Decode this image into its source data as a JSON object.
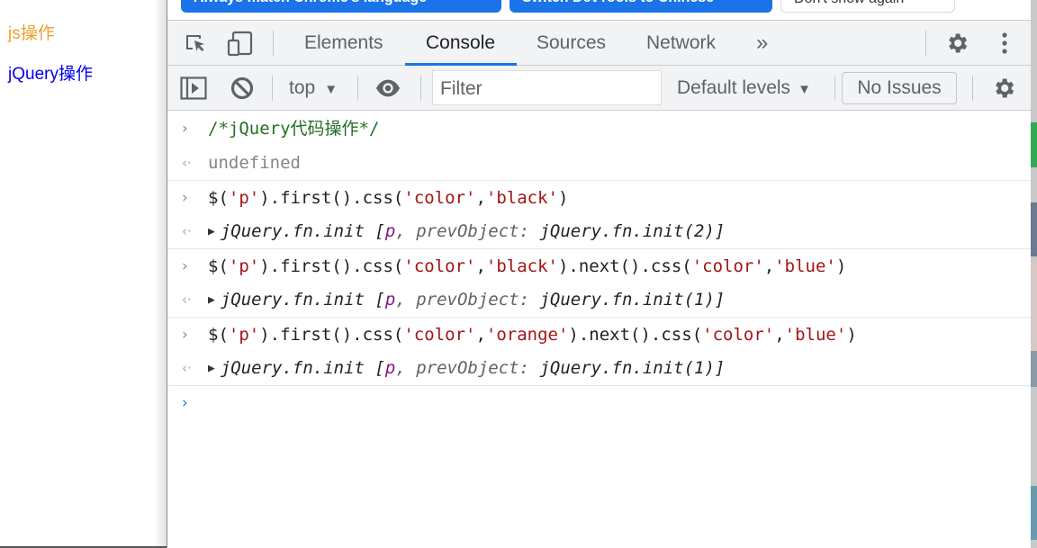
{
  "page": {
    "paragraphs": [
      {
        "text": "js操作",
        "color": "#f0a030"
      },
      {
        "text": "jQuery操作",
        "color": "#0000ee"
      }
    ]
  },
  "infobar": {
    "buttons": [
      "Always match Chrome's language",
      "Switch DevTools to Chinese",
      "Don't show again"
    ]
  },
  "tabbar": {
    "icons": [
      "inspect-element-icon",
      "device-toolbar-icon"
    ],
    "tabs": [
      {
        "label": "Elements",
        "active": false
      },
      {
        "label": "Console",
        "active": true
      },
      {
        "label": "Sources",
        "active": false
      },
      {
        "label": "Network",
        "active": false
      }
    ],
    "more_tabs": "»",
    "accent": "#1a73e8"
  },
  "toolbar": {
    "context": "top",
    "filter_placeholder": "Filter",
    "levels": "Default levels",
    "issues": "No Issues"
  },
  "console": {
    "entries": [
      {
        "input": [
          {
            "t": "cmt",
            "v": "/*jQuery代码操作*/"
          }
        ],
        "output": {
          "type": "undefined",
          "text": "undefined"
        }
      },
      {
        "input": [
          {
            "t": "plain",
            "v": "$("
          },
          {
            "t": "str",
            "v": "'p'"
          },
          {
            "t": "plain",
            "v": ").first().css("
          },
          {
            "t": "str",
            "v": "'color'"
          },
          {
            "t": "plain",
            "v": ","
          },
          {
            "t": "str",
            "v": "'black'"
          },
          {
            "t": "plain",
            "v": ")"
          }
        ],
        "output": {
          "type": "object",
          "head": "jQuery.fn.init [",
          "p": "p",
          "key": ", prevObject:",
          "tail": " jQuery.fn.init(2)]"
        }
      },
      {
        "input": [
          {
            "t": "plain",
            "v": "$("
          },
          {
            "t": "str",
            "v": "'p'"
          },
          {
            "t": "plain",
            "v": ").first().css("
          },
          {
            "t": "str",
            "v": "'color'"
          },
          {
            "t": "plain",
            "v": ","
          },
          {
            "t": "str",
            "v": "'black'"
          },
          {
            "t": "plain",
            "v": ").next().css("
          },
          {
            "t": "str",
            "v": "'color'"
          },
          {
            "t": "plain",
            "v": ","
          },
          {
            "t": "str",
            "v": "'blue'"
          },
          {
            "t": "plain",
            "v": ")"
          }
        ],
        "output": {
          "type": "object",
          "head": "jQuery.fn.init [",
          "p": "p",
          "key": ", prevObject:",
          "tail": " jQuery.fn.init(1)]"
        }
      },
      {
        "input": [
          {
            "t": "plain",
            "v": "$("
          },
          {
            "t": "str",
            "v": "'p'"
          },
          {
            "t": "plain",
            "v": ").first().css("
          },
          {
            "t": "str",
            "v": "'color'"
          },
          {
            "t": "plain",
            "v": ","
          },
          {
            "t": "str",
            "v": "'orange'"
          },
          {
            "t": "plain",
            "v": ").next().css("
          },
          {
            "t": "str",
            "v": "'color'"
          },
          {
            "t": "plain",
            "v": ","
          },
          {
            "t": "str",
            "v": "'blue'"
          },
          {
            "t": "plain",
            "v": ")"
          }
        ],
        "output": {
          "type": "object",
          "head": "jQuery.fn.init [",
          "p": "p",
          "key": ", prevObject:",
          "tail": " jQuery.fn.init(1)]"
        }
      }
    ],
    "prompt": ">",
    "input_marker": ">",
    "result_marker": "<·"
  }
}
